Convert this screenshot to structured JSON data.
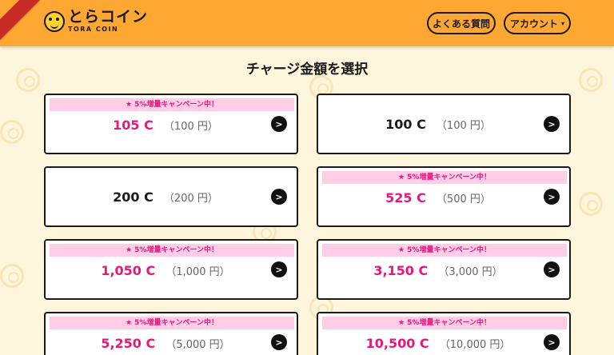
{
  "header": {
    "logo_main": "とらコイン",
    "logo_sub": "TORA COIN",
    "faq_label": "よくある質問",
    "account_label": "アカウント",
    "account_caret": "▾",
    "accent_color": "#ffa733"
  },
  "page_title": "チャージ金額を選択",
  "promo_text": "★ 5%増量キャンペーン中！",
  "arrow_glyph": ">",
  "options": [
    {
      "coins": "105 C",
      "yen": "（100 円）",
      "promo": true
    },
    {
      "coins": "100 C",
      "yen": "（100 円）",
      "promo": false
    },
    {
      "coins": "200 C",
      "yen": "（200 円）",
      "promo": false
    },
    {
      "coins": "525 C",
      "yen": "（500 円）",
      "promo": true
    },
    {
      "coins": "1,050 C",
      "yen": "（1,000 円）",
      "promo": true
    },
    {
      "coins": "3,150 C",
      "yen": "（3,000 円）",
      "promo": true
    },
    {
      "coins": "5,250 C",
      "yen": "（5,000 円）",
      "promo": true
    },
    {
      "coins": "10,500 C",
      "yen": "（10,000 円）",
      "promo": true
    }
  ]
}
